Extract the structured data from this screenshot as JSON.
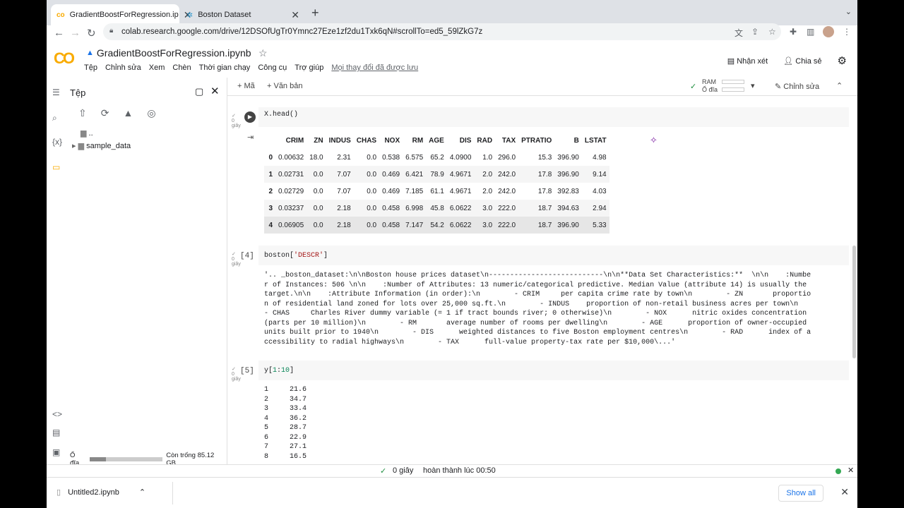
{
  "browser": {
    "tabs": [
      {
        "title": "GradientBoostForRegression.ip",
        "active": true
      },
      {
        "title": "Boston Dataset",
        "active": false
      }
    ],
    "url": "colab.research.google.com/drive/12DSOfUgTr0Ymnc27Eze1zf2du1Txk6qN#scrollTo=ed5_59lZkG7z"
  },
  "colab": {
    "logo": "CO",
    "notebook_title": "GradientBoostForRegression.ipynb",
    "menu": [
      "Tệp",
      "Chỉnh sửa",
      "Xem",
      "Chèn",
      "Thời gian chạy",
      "Công cụ",
      "Trợ giúp"
    ],
    "save_status": "Mọi thay đổi đã được lưu",
    "comment_label": "Nhận xét",
    "share_label": "Chia sẻ",
    "toolbar": {
      "add_code": "+ Mã",
      "add_text": "+ Văn bản",
      "ram_label": "RAM",
      "disk_label": "Ổ đĩa",
      "edit_label": "Chỉnh sửa"
    }
  },
  "sidebar": {
    "title": "Tệp",
    "parent_dir": "..",
    "folder": "sample_data",
    "disk_label": "Ổ đĩa",
    "disk_free": "Còn trống 85.12 GB"
  },
  "cells": {
    "c1": {
      "code": "X.head()",
      "gutter": "0\ngiây"
    },
    "df_columns": [
      "",
      "CRIM",
      "ZN",
      "INDUS",
      "CHAS",
      "NOX",
      "RM",
      "AGE",
      "DIS",
      "RAD",
      "TAX",
      "PTRATIO",
      "B",
      "LSTAT"
    ],
    "df_rows": [
      [
        "0",
        "0.00632",
        "18.0",
        "2.31",
        "0.0",
        "0.538",
        "6.575",
        "65.2",
        "4.0900",
        "1.0",
        "296.0",
        "15.3",
        "396.90",
        "4.98"
      ],
      [
        "1",
        "0.02731",
        "0.0",
        "7.07",
        "0.0",
        "0.469",
        "6.421",
        "78.9",
        "4.9671",
        "2.0",
        "242.0",
        "17.8",
        "396.90",
        "9.14"
      ],
      [
        "2",
        "0.02729",
        "0.0",
        "7.07",
        "0.0",
        "0.469",
        "7.185",
        "61.1",
        "4.9671",
        "2.0",
        "242.0",
        "17.8",
        "392.83",
        "4.03"
      ],
      [
        "3",
        "0.03237",
        "0.0",
        "2.18",
        "0.0",
        "0.458",
        "6.998",
        "45.8",
        "6.0622",
        "3.0",
        "222.0",
        "18.7",
        "394.63",
        "2.94"
      ],
      [
        "4",
        "0.06905",
        "0.0",
        "2.18",
        "0.0",
        "0.458",
        "7.147",
        "54.2",
        "6.0622",
        "3.0",
        "222.0",
        "18.7",
        "396.90",
        "5.33"
      ]
    ],
    "c2": {
      "exec": "[4]",
      "code_a": "boston[",
      "code_str": "'DESCR'",
      "code_b": "]"
    },
    "c2_output": [
      "'.. _boston_dataset:\\n\\nBoston house prices dataset\\n---------------------------\\n\\n**Data Set Characteristics:**  \\n\\n    :Numbe",
      "r of Instances: 506 \\n\\n    :Number of Attributes: 13 numeric/categorical predictive. Median Value (attribute 14) is usually the",
      "target.\\n\\n    :Attribute Information (in order):\\n        - CRIM     per capita crime rate by town\\n        - ZN       proportio",
      "n of residential land zoned for lots over 25,000 sq.ft.\\n        - INDUS    proportion of non-retail business acres per town\\n",
      "- CHAS     Charles River dummy variable (= 1 if tract bounds river; 0 otherwise)\\n        - NOX      nitric oxides concentration",
      "(parts per 10 million)\\n        - RM       average number of rooms per dwelling\\n        - AGE      proportion of owner-occupied",
      "units built prior to 1940\\n        - DIS      weighted distances to five Boston employment centres\\n        - RAD      index of a",
      "ccessibility to radial highways\\n        - TAX      full-value property-tax rate per $10,000\\...'"
    ],
    "c3": {
      "exec": "[5]",
      "code_a": "y[",
      "code_n1": "1",
      "code_colon": ":",
      "code_n2": "10",
      "code_b": "]"
    },
    "c3_output": [
      "1     21.6",
      "2     34.7",
      "3     33.4",
      "4     36.2",
      "5     28.7",
      "6     22.9",
      "7     27.1",
      "8     16.5"
    ]
  },
  "status": {
    "time": "0 giây",
    "completed": "hoàn thành lúc 00:50"
  },
  "downloads": {
    "file": "Untitled2.ipynb",
    "show_all": "Show all"
  }
}
